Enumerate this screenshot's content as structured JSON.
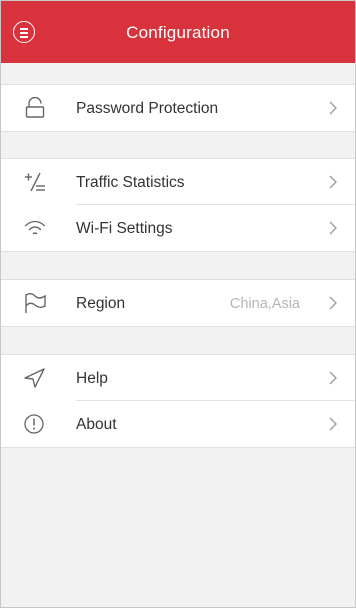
{
  "header": {
    "title": "Configuration",
    "menu_icon": "menu-circle-icon",
    "background_color": "#d8333c"
  },
  "groups": [
    {
      "items": [
        {
          "label": "Password Protection",
          "icon": "lock-icon"
        }
      ]
    },
    {
      "items": [
        {
          "label": "Traffic Statistics",
          "icon": "traffic-stats-icon"
        },
        {
          "label": "Wi-Fi Settings",
          "icon": "wifi-icon"
        }
      ]
    },
    {
      "items": [
        {
          "label": "Region",
          "value": "China,Asia",
          "icon": "flag-icon"
        }
      ]
    },
    {
      "items": [
        {
          "label": "Help",
          "icon": "send-icon"
        },
        {
          "label": "About",
          "icon": "info-icon"
        }
      ]
    }
  ],
  "colors": {
    "accent": "#d8333c",
    "background": "#f2f2f2",
    "row_background": "#ffffff",
    "text": "#333333",
    "secondary_text": "#b5b5b5"
  }
}
